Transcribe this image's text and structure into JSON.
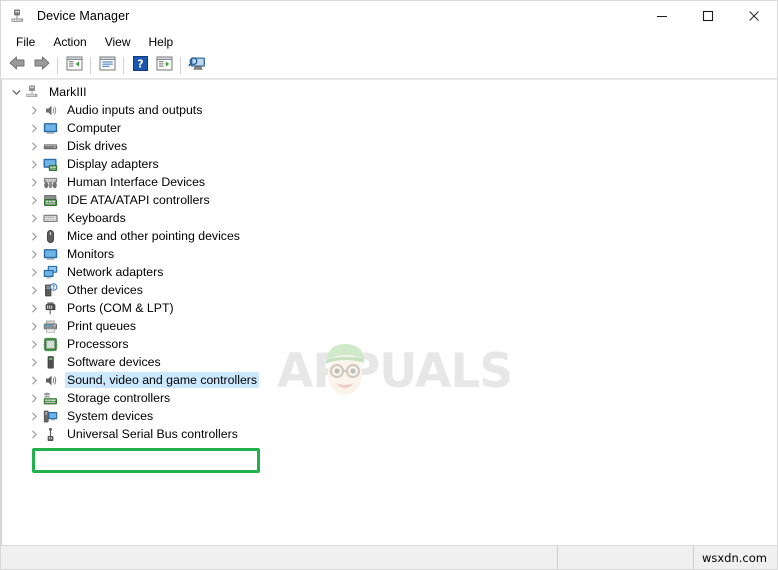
{
  "window": {
    "title": "Device Manager",
    "icon": "device-manager-icon",
    "controls": {
      "minimize": "minimize-icon",
      "maximize": "maximize-icon",
      "close": "close-icon"
    }
  },
  "menubar": {
    "items": [
      {
        "label": "File"
      },
      {
        "label": "Action"
      },
      {
        "label": "View"
      },
      {
        "label": "Help"
      }
    ]
  },
  "toolbar": {
    "buttons": [
      {
        "name": "back-button",
        "icon": "back-arrow-icon"
      },
      {
        "name": "forward-button",
        "icon": "forward-arrow-icon"
      },
      {
        "name": "show-hide-console-tree-button",
        "icon": "console-tree-icon"
      },
      {
        "name": "properties-button",
        "icon": "properties-icon"
      },
      {
        "name": "help-button",
        "icon": "help-question-icon"
      },
      {
        "name": "update-driver-button",
        "icon": "update-driver-icon"
      },
      {
        "name": "scan-hardware-changes-button",
        "icon": "scan-monitor-icon"
      }
    ]
  },
  "tree": {
    "root": {
      "label": "MarkIII",
      "icon": "computer-root-icon",
      "expanded": true
    },
    "items": [
      {
        "label": "Audio inputs and outputs",
        "icon": "speaker-icon"
      },
      {
        "label": "Computer",
        "icon": "monitor-icon"
      },
      {
        "label": "Disk drives",
        "icon": "disk-drive-icon"
      },
      {
        "label": "Display adapters",
        "icon": "display-adapter-icon"
      },
      {
        "label": "Human Interface Devices",
        "icon": "hid-icon"
      },
      {
        "label": "IDE ATA/ATAPI controllers",
        "icon": "ide-controller-icon"
      },
      {
        "label": "Keyboards",
        "icon": "keyboard-icon"
      },
      {
        "label": "Mice and other pointing devices",
        "icon": "mouse-icon"
      },
      {
        "label": "Monitors",
        "icon": "monitor-icon"
      },
      {
        "label": "Network adapters",
        "icon": "network-adapter-icon"
      },
      {
        "label": "Other devices",
        "icon": "other-devices-icon"
      },
      {
        "label": "Ports (COM & LPT)",
        "icon": "port-icon"
      },
      {
        "label": "Print queues",
        "icon": "printer-icon"
      },
      {
        "label": "Processors",
        "icon": "processor-icon"
      },
      {
        "label": "Software devices",
        "icon": "software-device-icon"
      },
      {
        "label": "Sound, video and game controllers",
        "icon": "speaker-icon",
        "selected": true,
        "highlighted": true
      },
      {
        "label": "Storage controllers",
        "icon": "storage-controller-icon"
      },
      {
        "label": "System devices",
        "icon": "system-device-icon"
      },
      {
        "label": "Universal Serial Bus controllers",
        "icon": "usb-icon"
      }
    ]
  },
  "annotation": {
    "highlight_color": "#22b14c",
    "selection_color": "#cce8ff"
  },
  "watermark": {
    "text": "APPUALS",
    "logo": "appuals-face-logo"
  },
  "statusbar": {
    "main": "",
    "middle": "",
    "right": "wsxdn.com"
  }
}
